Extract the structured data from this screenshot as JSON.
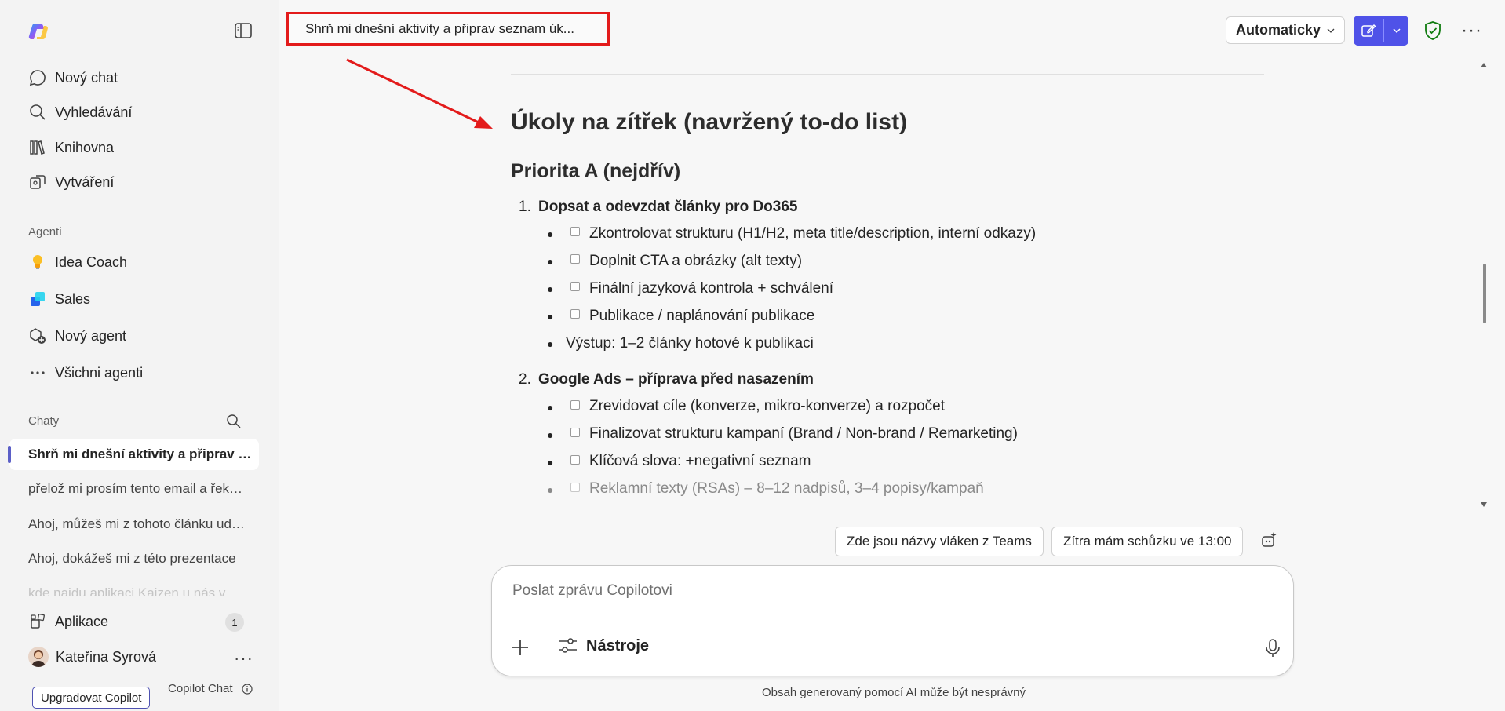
{
  "sidebar": {
    "nav": [
      {
        "label": "Nový chat",
        "icon": "chat-bubble-icon"
      },
      {
        "label": "Vyhledávání",
        "icon": "search-icon"
      },
      {
        "label": "Knihovna",
        "icon": "library-icon"
      },
      {
        "label": "Vytváření",
        "icon": "create-icon"
      }
    ],
    "agents_label": "Agenti",
    "agents": [
      {
        "label": "Idea Coach",
        "icon": "lightbulb-icon"
      },
      {
        "label": "Sales",
        "icon": "sales-icon"
      },
      {
        "label": "Nový agent",
        "icon": "new-agent-icon"
      },
      {
        "label": "Všichni agenti",
        "icon": "more-icon"
      }
    ],
    "chats_label": "Chaty",
    "chats": [
      "Shrň mi dnešní aktivity a připrav seznam úkolů",
      "přelož mi prosím tento email a řekni mi",
      "Ahoj, můžeš mi z tohoto článku udělat",
      "Ahoj, dokážeš mi z této prezentace",
      "kde najdu aplikaci Kaizen u nás v"
    ],
    "apps_label": "Aplikace",
    "apps_badge": "1",
    "user_name": "Kateřina Syrová",
    "upgrade_label": "Upgradovat Copilot",
    "product_label": "Copilot Chat"
  },
  "topbar": {
    "conversation_title": "Shrň mi dnešní aktivity a připrav seznam úk...",
    "model_label": "Automaticky"
  },
  "content": {
    "heading": "Úkoly na zítřek (navržený to-do list)",
    "subheading": "Priorita A (nejdřív)",
    "sections": [
      {
        "number": "1.",
        "title": "Dopsat a odevzdat články pro Do365",
        "items": [
          {
            "text": "Zkontrolovat strukturu (H1/H2, meta title/description, interní odkazy)",
            "checkbox": true
          },
          {
            "text": "Doplnit CTA a obrázky (alt texty)",
            "checkbox": true
          },
          {
            "text": "Finální jazyková kontrola + schválení",
            "checkbox": true
          },
          {
            "text": "Publikace / naplánování publikace",
            "checkbox": true
          },
          {
            "text": "Výstup: 1–2 články hotové k publikaci",
            "checkbox": false
          }
        ]
      },
      {
        "number": "2.",
        "title": "Google Ads – příprava před nasazením",
        "items": [
          {
            "text": "Zrevidovat cíle (konverze, mikro-konverze) a rozpočet",
            "checkbox": true
          },
          {
            "text": "Finalizovat strukturu kampaní (Brand / Non-brand / Remarketing)",
            "checkbox": true
          },
          {
            "text": "Klíčová slova: +negativní seznam",
            "checkbox": true
          },
          {
            "text": "Reklamní texty (RSAs) – 8–12 nadpisů, 3–4 popisy/kampaň",
            "checkbox": true
          }
        ]
      }
    ]
  },
  "suggestions": [
    "Zde jsou názvy vláken z Teams",
    "Zítra mám schůzku ve 13:00"
  ],
  "composer": {
    "placeholder": "Poslat zprávu Copilotovi",
    "tools_label": "Nástroje"
  },
  "disclaimer": "Obsah generovaný pomocí AI může být nesprávný",
  "colors": {
    "accent": "#4f52e8",
    "annotation_red": "#e31b1b",
    "shield_green": "#107c10"
  }
}
